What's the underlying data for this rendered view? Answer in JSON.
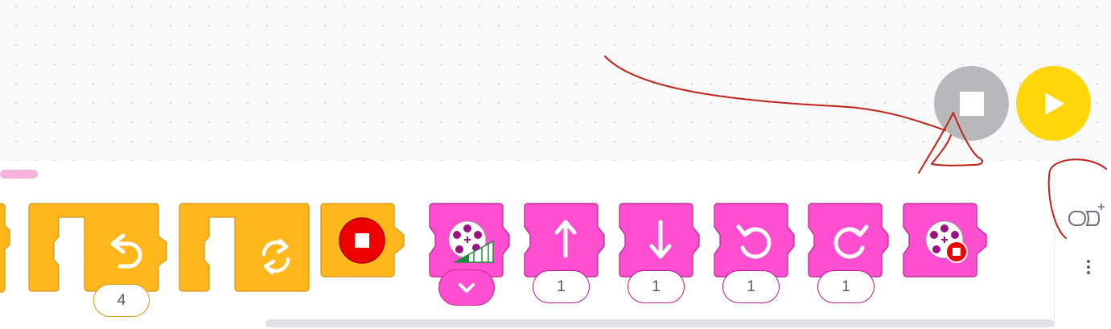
{
  "colors": {
    "orange_block": "#ffb71b",
    "orange_border": "#d3951d",
    "pink_block": "#ff4fd0",
    "pink_border": "#b7228f",
    "stop_red": "#ee0000",
    "play_yellow": "#ffd60a",
    "stop_gray": "#b8b8bb",
    "annotation_red": "#c0221a"
  },
  "controls": {
    "stop_icon": "stop-square-icon",
    "play_icon": "play-triangle-icon"
  },
  "palette": {
    "blocks": [
      {
        "id": "partial-orange",
        "icon": "cut-off-block"
      },
      {
        "id": "repeat-times",
        "icon": "undo-arrow-icon",
        "param": "4"
      },
      {
        "id": "repeat-forever",
        "icon": "loop-arrows-icon"
      },
      {
        "id": "stop-program",
        "icon": "stop-red-icon"
      },
      {
        "id": "motor-speed",
        "icon": "motor-speed-icon",
        "dropdown": "chevron-down-icon"
      },
      {
        "id": "move-up",
        "icon": "arrow-up-icon",
        "param": "1"
      },
      {
        "id": "move-down",
        "icon": "arrow-down-icon",
        "param": "1"
      },
      {
        "id": "turn-left",
        "icon": "rotate-ccw-icon",
        "param": "1"
      },
      {
        "id": "turn-right",
        "icon": "rotate-cw-icon",
        "param": "1"
      },
      {
        "id": "motor-stop",
        "icon": "motor-stop-icon"
      }
    ]
  },
  "side_panel": {
    "extension_icon": "add-extension-icon",
    "more_icon": "more-vertical-icon"
  }
}
